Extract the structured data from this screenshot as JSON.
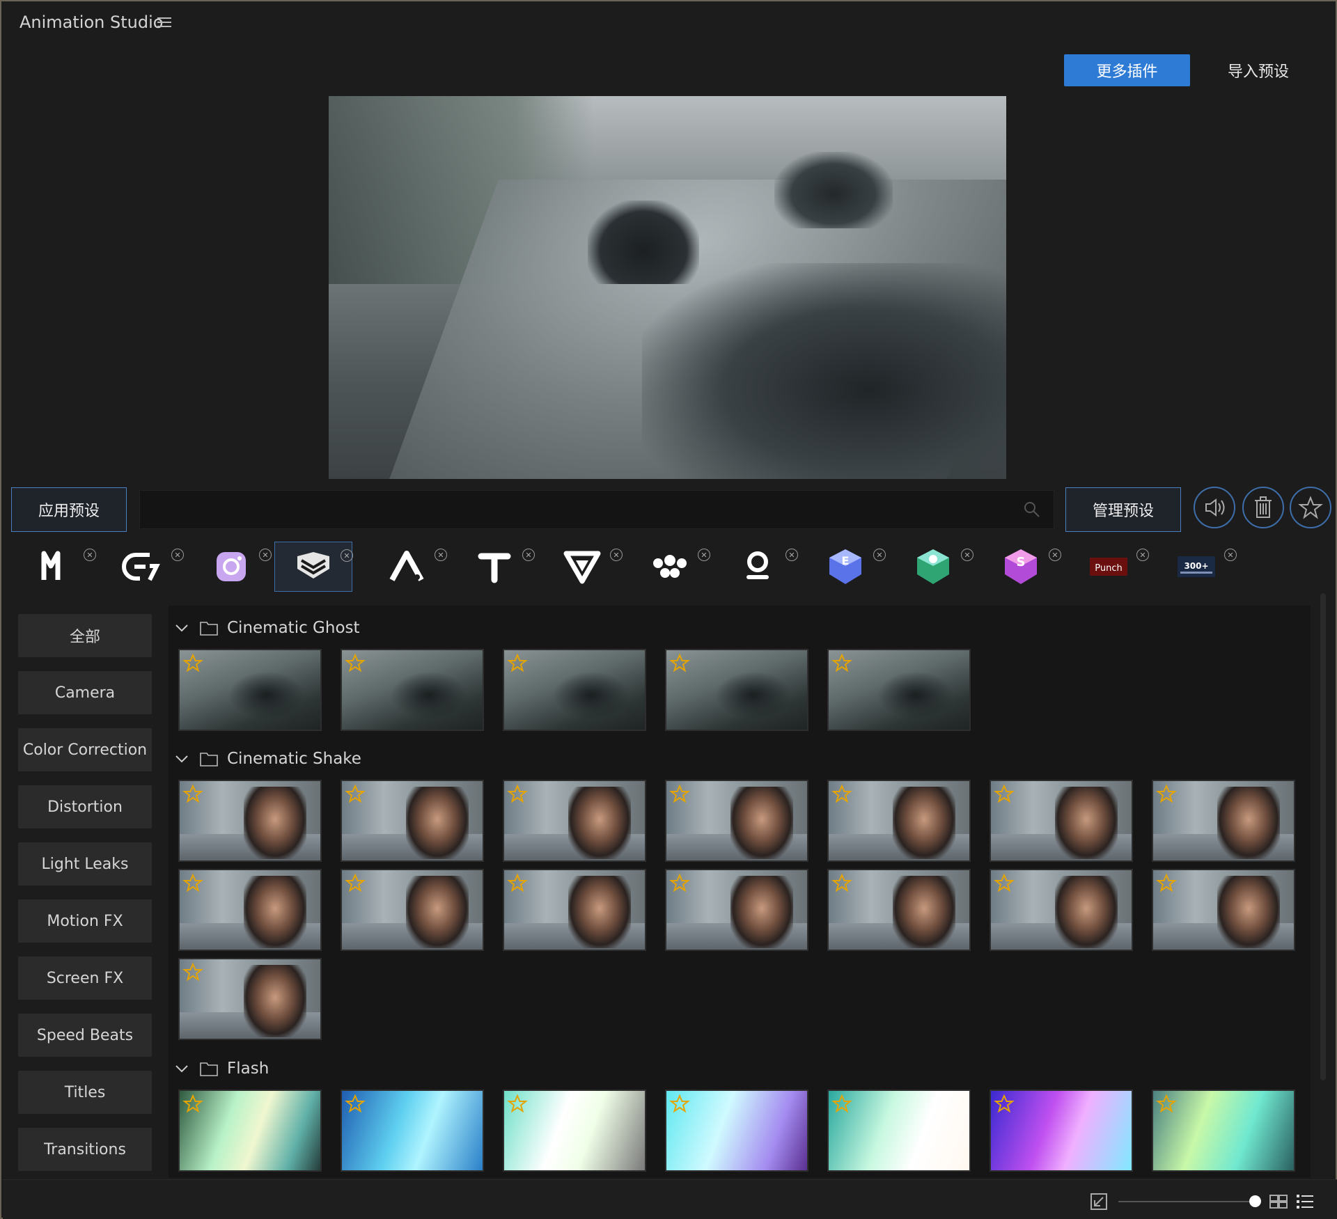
{
  "app": {
    "title": "Animation Studio"
  },
  "topbar": {
    "more_plugins": "更多插件",
    "import_presets": "导入预设"
  },
  "toolbar": {
    "apply_preset": "应用预设",
    "manage_presets": "管理预设",
    "search_placeholder": ""
  },
  "plugins": [
    {
      "name": "m-logo",
      "selected": false
    },
    {
      "name": "e-logo",
      "selected": false
    },
    {
      "name": "camera-logo",
      "selected": false
    },
    {
      "name": "shield-logo",
      "selected": true
    },
    {
      "name": "a-logo",
      "selected": false
    },
    {
      "name": "t-logo",
      "selected": false
    },
    {
      "name": "v-logo",
      "selected": false
    },
    {
      "name": "dots-logo",
      "selected": false
    },
    {
      "name": "q-logo",
      "selected": false
    },
    {
      "name": "e-cube-logo",
      "selected": false
    },
    {
      "name": "green-cube-logo",
      "selected": false
    },
    {
      "name": "s-cube-logo",
      "selected": false
    },
    {
      "name": "punch-logo",
      "label": "Punch",
      "selected": false
    },
    {
      "name": "300-logo",
      "label": "300+",
      "selected": false
    }
  ],
  "categories": [
    "全部",
    "Camera",
    "Color Correction",
    "Distortion",
    "Light Leaks",
    "Motion FX",
    "Screen FX",
    "Speed Beats",
    "Titles",
    "Transitions"
  ],
  "groups": [
    {
      "title": "Cinematic Ghost",
      "count": 5
    },
    {
      "title": "Cinematic Shake",
      "count": 15
    },
    {
      "title": "Flash",
      "count": 7
    }
  ],
  "colors": {
    "accent": "#2e7bd6",
    "selection_border": "#3d6ea9",
    "star": "#e6a400"
  }
}
